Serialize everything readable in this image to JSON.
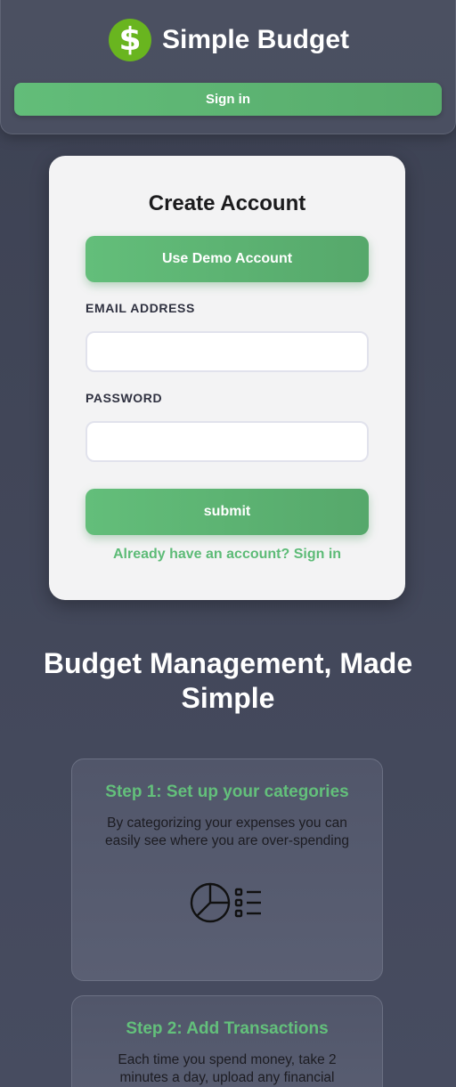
{
  "header": {
    "brand_name": "Simple Budget",
    "logo_symbol": "$",
    "signin_label": "Sign in"
  },
  "form": {
    "title": "Create Account",
    "demo_label": "Use Demo Account",
    "email_label": "EMAIL ADDRESS",
    "email_value": "",
    "password_label": "PASSWORD",
    "password_value": "",
    "submit_label": "submit",
    "signin_link": "Already have an account? Sign in"
  },
  "hero": {
    "title": "Budget Management, Made Simple"
  },
  "steps": [
    {
      "title": "Step 1: Set up your categories",
      "description": "By categorizing your expenses you can easily see where you are over-spending",
      "icon": "pie-chart-list-icon"
    },
    {
      "title": "Step 2: Add Transactions",
      "description": "Each time you spend money, take 2 minutes a day, upload any financial"
    }
  ],
  "colors": {
    "accent": "#5dbb77",
    "logo": "#69b51f",
    "background": "#414658",
    "card": "#f3f3f4"
  }
}
